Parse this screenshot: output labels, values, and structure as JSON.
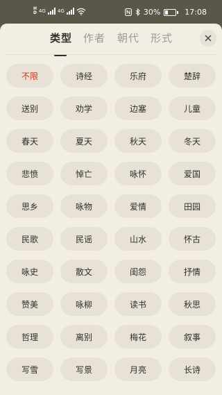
{
  "status_bar": {
    "network_1": "4G",
    "network_2": "4G",
    "battery": "30%",
    "time": "17:08",
    "battery_level": 0.3
  },
  "tabs": [
    {
      "label": "类型",
      "active": true
    },
    {
      "label": "作者",
      "active": false
    },
    {
      "label": "朝代",
      "active": false
    },
    {
      "label": "形式",
      "active": false
    }
  ],
  "close_icon": "close-icon",
  "colors": {
    "status_bar_bg": "#5a5648",
    "sheet_bg": "#f2eee3",
    "chip_bg": "#e7e2d5",
    "selected_text": "#c0392b"
  },
  "categories": [
    {
      "label": "不限",
      "selected": true
    },
    {
      "label": "诗经"
    },
    {
      "label": "乐府"
    },
    {
      "label": "楚辞"
    },
    {
      "label": "送别"
    },
    {
      "label": "劝学"
    },
    {
      "label": "边塞"
    },
    {
      "label": "儿童"
    },
    {
      "label": "春天"
    },
    {
      "label": "夏天"
    },
    {
      "label": "秋天"
    },
    {
      "label": "冬天"
    },
    {
      "label": "悲愤"
    },
    {
      "label": "悼亡"
    },
    {
      "label": "咏怀"
    },
    {
      "label": "爱国"
    },
    {
      "label": "思乡"
    },
    {
      "label": "咏物"
    },
    {
      "label": "爱情"
    },
    {
      "label": "田园"
    },
    {
      "label": "民歌"
    },
    {
      "label": "民谣"
    },
    {
      "label": "山水"
    },
    {
      "label": "怀古"
    },
    {
      "label": "咏史"
    },
    {
      "label": "散文"
    },
    {
      "label": "闺怨"
    },
    {
      "label": "抒情"
    },
    {
      "label": "赞美"
    },
    {
      "label": "咏柳"
    },
    {
      "label": "读书"
    },
    {
      "label": "秋思"
    },
    {
      "label": "哲理"
    },
    {
      "label": "离别"
    },
    {
      "label": "梅花"
    },
    {
      "label": "叙事"
    },
    {
      "label": "写雪"
    },
    {
      "label": "写景"
    },
    {
      "label": "月亮"
    },
    {
      "label": "长诗"
    }
  ]
}
